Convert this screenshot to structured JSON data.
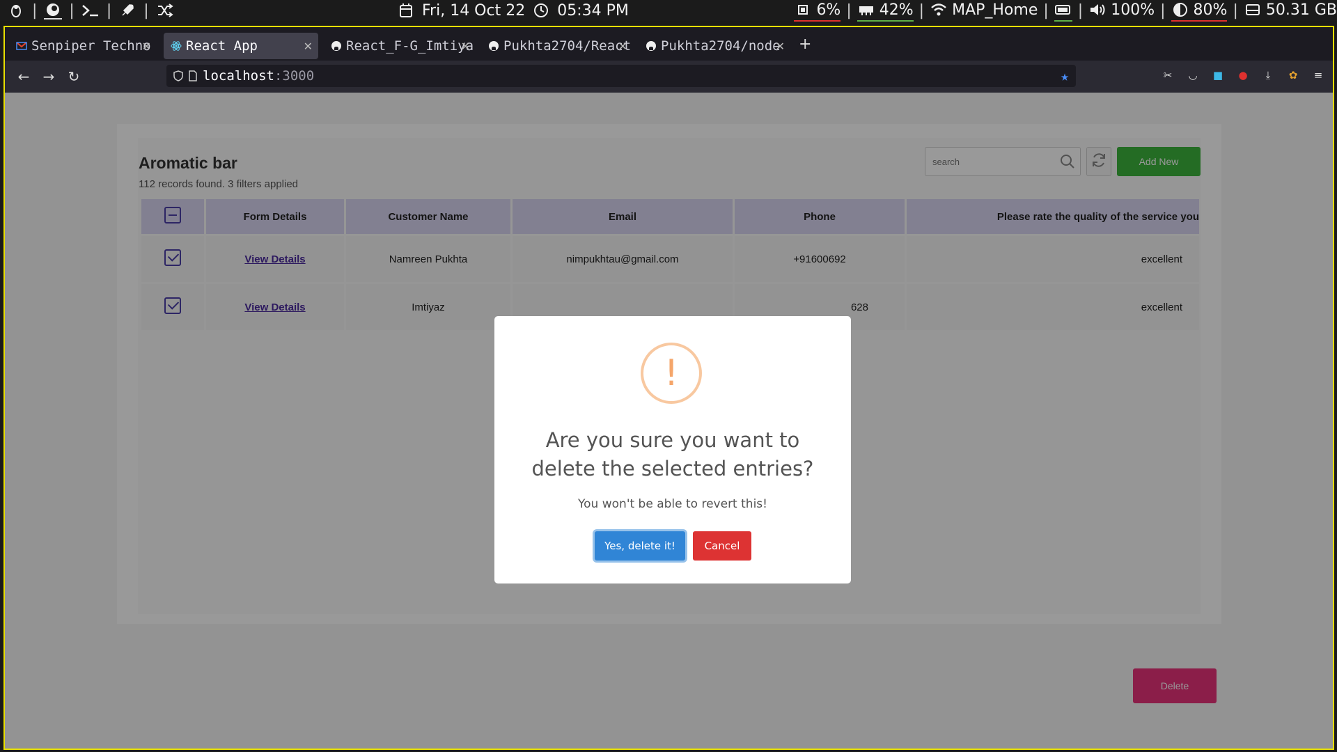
{
  "system_bar": {
    "date": "Fri, 14 Oct 22",
    "time": "05:34 PM",
    "cpu": "6%",
    "memory": "42%",
    "wifi": "MAP_Home",
    "volume": "100%",
    "brightness": "80%",
    "disk": "50.31 GB"
  },
  "browser": {
    "tabs": [
      {
        "label": "Senpiper Techno",
        "icon": "gmail-icon"
      },
      {
        "label": "React App",
        "icon": "react-icon"
      },
      {
        "label": "React_F-G_Imtiya",
        "icon": "github-icon"
      },
      {
        "label": "Pukhta2704/React",
        "icon": "github-icon"
      },
      {
        "label": "Pukhta2704/node",
        "icon": "github-icon"
      }
    ],
    "url_host": "localhost",
    "url_port": ":3000"
  },
  "page": {
    "title": "Aromatic bar",
    "subtitle": "112 records found. 3 filters applied",
    "search_placeholder": "search",
    "add_new_label": "Add New",
    "delete_label": "Delete",
    "table": {
      "headers": [
        "Form Details",
        "Customer Name",
        "Email",
        "Phone",
        "Please rate the quality of the service you"
      ],
      "rows": [
        {
          "form": "View Details",
          "name": "Namreen Pukhta",
          "email": "nimpukhtau@gmail.com",
          "phone": "+91600692",
          "rating": "excellent"
        },
        {
          "form": "View Details",
          "name": "Imtiyaz",
          "email": "",
          "phone": "628",
          "rating": "excellent"
        }
      ]
    }
  },
  "dialog": {
    "icon": "!",
    "title": "Are you sure you want to delete the selected entries?",
    "text": "You won't be able to revert this!",
    "confirm_label": "Yes, delete it!",
    "cancel_label": "Cancel"
  }
}
